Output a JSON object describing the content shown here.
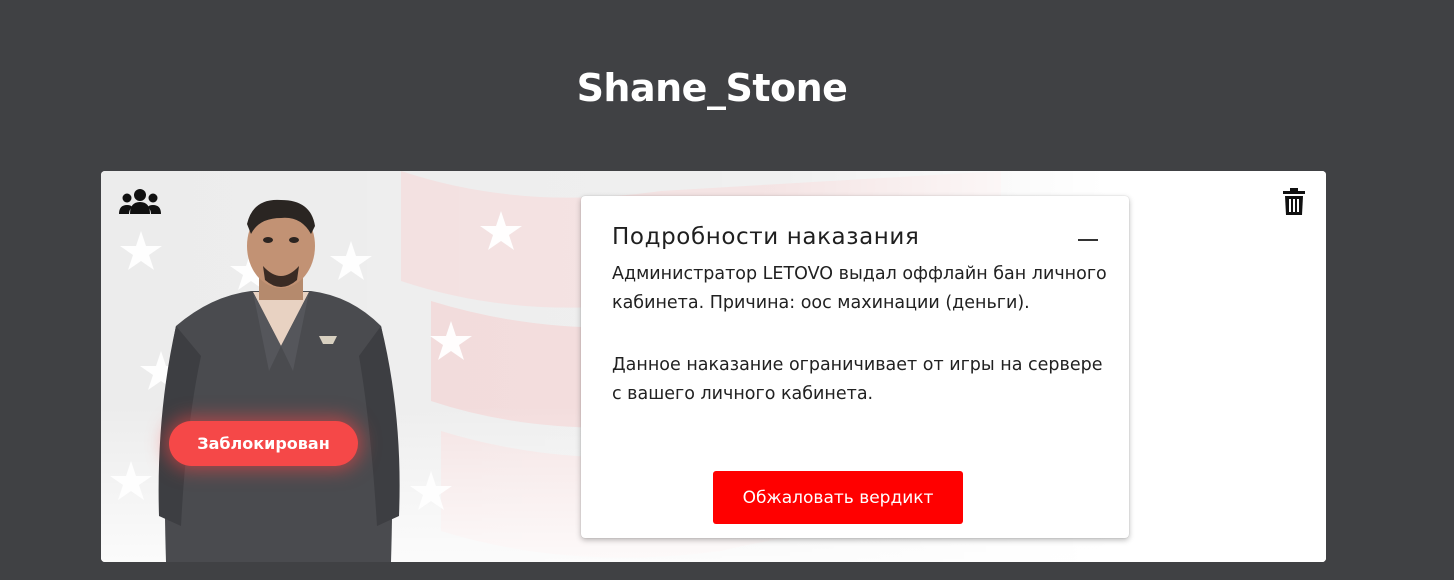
{
  "page": {
    "title": "Shane_Stone"
  },
  "card": {
    "icons": {
      "group": "users-group-icon",
      "delete": "trash-icon"
    },
    "status_badge": "Заблокирован",
    "status_color": "#f54848",
    "punishment": {
      "heading": "Подробности наказания",
      "collapse_icon": "minus-icon",
      "description": "Администратор LETOVO выдал оффлайн бан личного кабинета. Причина: оос махинации (деньги).",
      "note": "Данное наказание ограничивает от игры на сервере с вашего личного кабинета.",
      "appeal_button": "Обжаловать вердикт",
      "appeal_color": "#ff0000"
    }
  }
}
